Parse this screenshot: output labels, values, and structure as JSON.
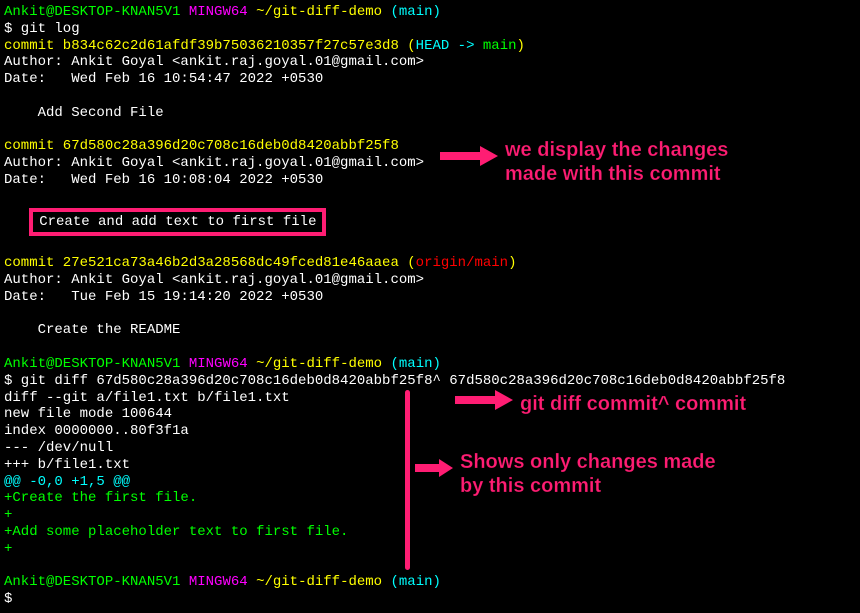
{
  "prompt1": {
    "user": "Ankit@DESKTOP-KNAN5V1",
    "sys": "MINGW64",
    "path": "~/git-diff-demo",
    "branch": "(main)"
  },
  "cmd1": "$ git log",
  "commit1": {
    "line": "commit b834c62c2d61afdf39b75036210357f27c57e3d8 (",
    "head": "HEAD -> ",
    "branch": "main",
    "close": ")",
    "author": "Author: Ankit Goyal <ankit.raj.goyal.01@gmail.com>",
    "date": "Date:   Wed Feb 16 10:54:47 2022 +0530",
    "msg": "    Add Second File"
  },
  "commit2": {
    "line": "commit 67d580c28a396d20c708c16deb0d8420abbf25f8",
    "author": "Author: Ankit Goyal <ankit.raj.goyal.01@gmail.com>",
    "date": "Date:   Wed Feb 16 10:08:04 2022 +0530",
    "msg": "Create and add text to first file"
  },
  "commit3": {
    "line": "commit 27e521ca73a46b2d3a28568dc49fced81e46aaea (",
    "origin": "origin/main",
    "close": ")",
    "author": "Author: Ankit Goyal <ankit.raj.goyal.01@gmail.com>",
    "date": "Date:   Tue Feb 15 19:14:20 2022 +0530",
    "msg": "    Create the README"
  },
  "prompt2": {
    "user": "Ankit@DESKTOP-KNAN5V1",
    "sys": "MINGW64",
    "path": "~/git-diff-demo",
    "branch": "(main)"
  },
  "cmd2": "$ git diff 67d580c28a396d20c708c16deb0d8420abbf25f8^ 67d580c28a396d20c708c16deb0d8420abbf25f8",
  "diff": {
    "l1": "diff --git a/file1.txt b/file1.txt",
    "l2": "new file mode 100644",
    "l3": "index 0000000..80f3f1a",
    "l4": "--- /dev/null",
    "l5": "+++ b/file1.txt",
    "hunk": "@@ -0,0 +1,5 @@",
    "add1": "+Create the first file.",
    "add2": "+",
    "add3": "+Add some placeholder text to first file.",
    "add4": "+"
  },
  "prompt3": {
    "user": "Ankit@DESKTOP-KNAN5V1",
    "sys": "MINGW64",
    "path": "~/git-diff-demo",
    "branch": "(main)"
  },
  "cmd3": "$ ",
  "annotations": {
    "a1": "we display the changes\nmade with this commit",
    "a2": "git diff commit^ commit",
    "a3": "Shows only changes made\nby this commit"
  }
}
